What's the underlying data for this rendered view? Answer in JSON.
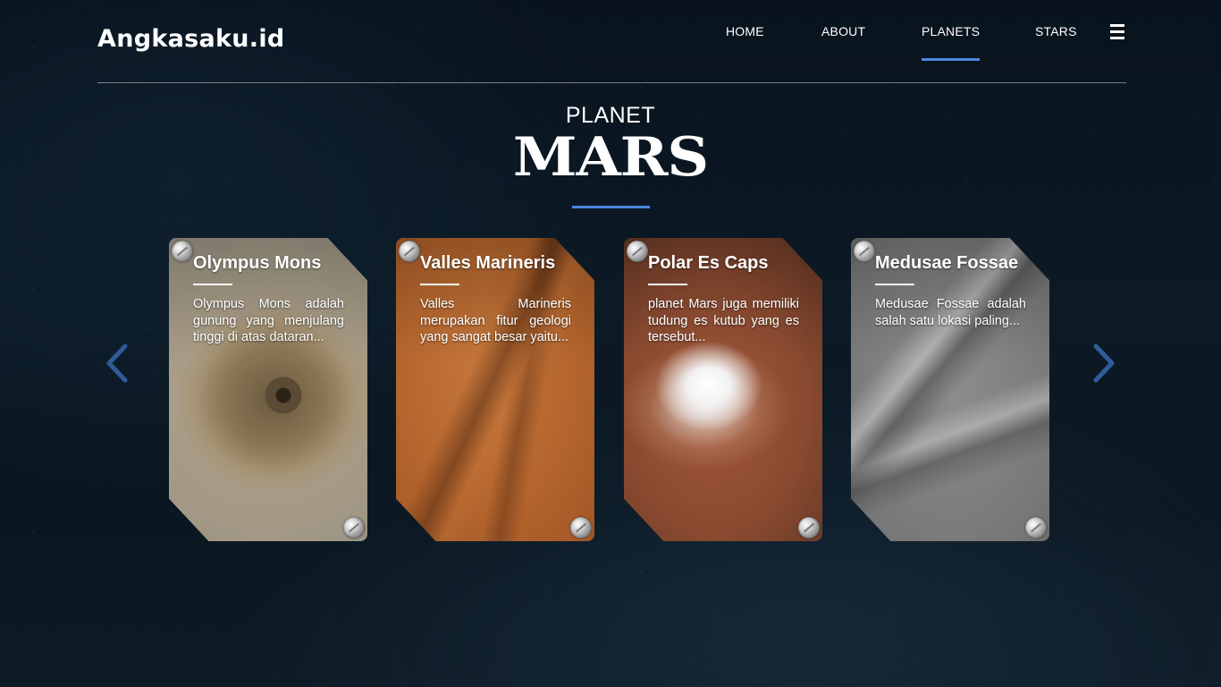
{
  "brand": {
    "logo": "Angkasaku.id"
  },
  "nav": {
    "items": [
      {
        "label": "HOME",
        "active": false
      },
      {
        "label": "ABOUT",
        "active": false
      },
      {
        "label": "PLANETS",
        "active": true
      },
      {
        "label": "STARS",
        "active": false
      }
    ],
    "menu_icon": "hamburger-icon"
  },
  "hero": {
    "subtitle": "PLANET",
    "title": "MARS"
  },
  "colors": {
    "accent": "#4a86e0",
    "arrow": "#2f5c99"
  },
  "carousel": {
    "prev_icon": "chevron-left-icon",
    "next_icon": "chevron-right-icon",
    "cards": [
      {
        "title": "Olympus Mons",
        "text": "Olympus Mons adalah gunung yang menjulang tinggi di atas dataran..."
      },
      {
        "title": "Valles Marineris",
        "text": "Valles Marineris merupakan fitur geologi yang sangat besar yaitu..."
      },
      {
        "title": "Polar Es Caps",
        "text": "planet Mars juga memiliki tudung es kutub yang es tersebut..."
      },
      {
        "title": "Medusae Fossae",
        "text": "Medusae Fossae adalah salah satu lokasi paling..."
      }
    ]
  }
}
